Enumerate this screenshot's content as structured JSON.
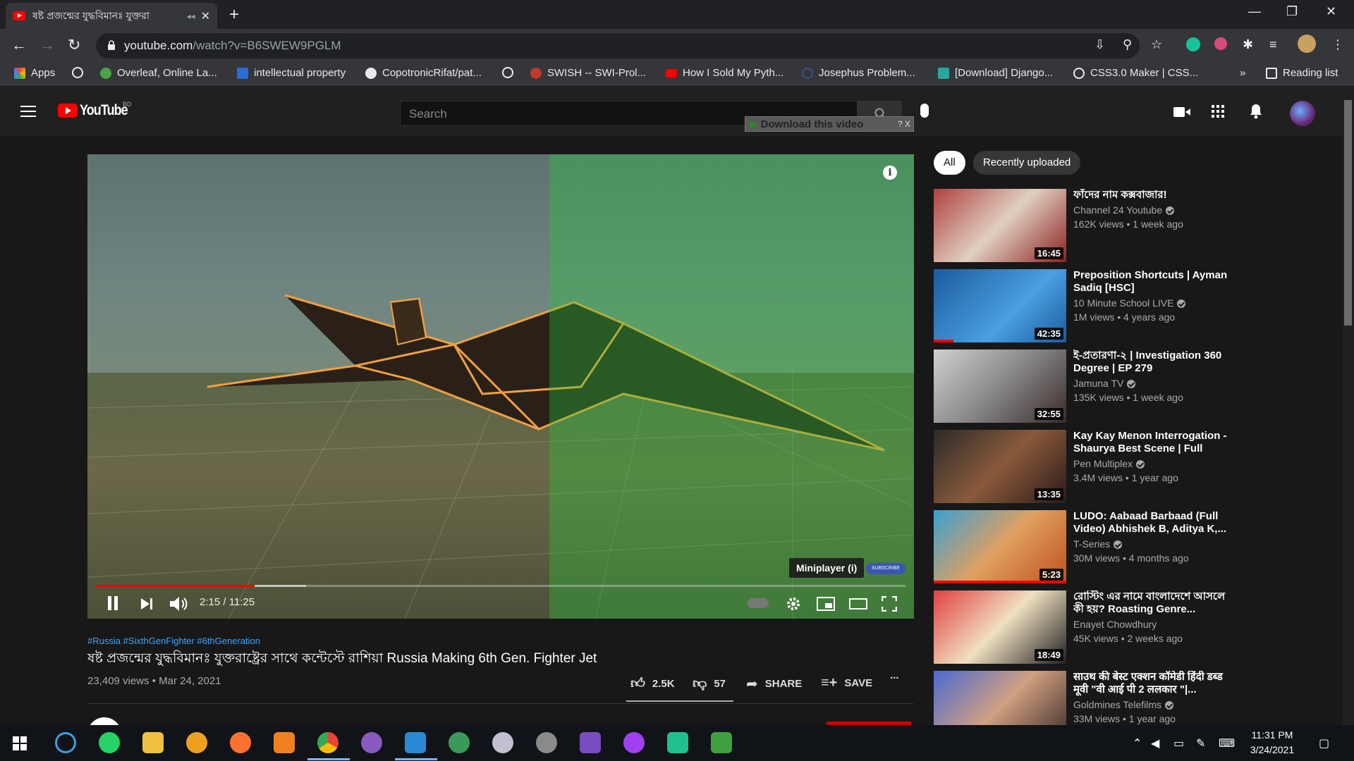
{
  "browser": {
    "tab_title": "ষষ্ট প্রজন্মের যুদ্ধবিমানঃ যুক্তরা",
    "url_host": "youtube.com",
    "url_path": "/watch?v=B6SWEW9PGLM",
    "window_controls": {
      "minimize": "—",
      "restore": "❐",
      "close": "✕"
    }
  },
  "bookmarks": [
    {
      "label": "Apps",
      "color": "#ea4335"
    },
    {
      "label": "",
      "color": "#e8eaed"
    },
    {
      "label": "Overleaf, Online La...",
      "color": "#46a546"
    },
    {
      "label": "intellectual property",
      "color": "#2b6cd6"
    },
    {
      "label": "CopotronicRifat/pat...",
      "color": "#e8eaed"
    },
    {
      "label": "",
      "color": "#e8eaed"
    },
    {
      "label": "SWISH -- SWI-Prol...",
      "color": "#c0392b"
    },
    {
      "label": "How I Sold My Pyth...",
      "color": "#ff0000"
    },
    {
      "label": "Josephus Problem...",
      "color": "#3a6fd6"
    },
    {
      "label": "[Download] Django...",
      "color": "#2aa6a0"
    },
    {
      "label": "CSS3.0 Maker | CSS...",
      "color": "#e8eaed"
    }
  ],
  "bookmarks_more": "»",
  "reading_list": "Reading list",
  "youtube": {
    "logo_text": "YouTube",
    "country": "BD",
    "search_placeholder": "Search",
    "download_overlay": "Download this video",
    "download_overlay_extra": "? X"
  },
  "player": {
    "time": "2:15 / 11:25",
    "progress_fraction": 0.196,
    "miniplayer_tip": "Miniplayer (i)",
    "watermark": "SUBSCRIBE"
  },
  "video": {
    "hashtags": "#Russia #SixthGenFighter #6thGeneration",
    "title": "ষষ্ট প্রজন্মের যুদ্ধবিমানঃ যুক্তরাষ্ট্রের সাথে কন্টেস্টে রাশিয়া Russia Making 6th Gen. Fighter Jet",
    "views_date": "23,409 views • Mar 24, 2021",
    "likes": "2.5K",
    "dislikes": "57",
    "share": "SHARE",
    "save": "SAVE",
    "more": "..."
  },
  "chips": [
    "All",
    "Recently uploaded"
  ],
  "recommendations": [
    {
      "title": "ফাঁদের নাম কক্সবাজার!",
      "channel": "Channel 24 Youtube",
      "views": "162K views • 1 week ago",
      "duration": "16:45",
      "thumb_color": "#b03030"
    },
    {
      "title": "Preposition Shortcuts | Ayman Sadiq [HSC]",
      "channel": "10 Minute School LIVE",
      "views": "1M views • 4 years ago",
      "duration": "42:35",
      "thumb_color": "#2a7ad6"
    },
    {
      "title": "ই-প্রতারণা-২ | Investigation 360 Degree | EP 279",
      "channel": "Jamuna TV",
      "views": "135K views • 1 week ago",
      "duration": "32:55",
      "thumb_color": "#a8a8a8"
    },
    {
      "title": "Kay Kay Menon Interrogation - Shaurya Best Scene | Full Hind...",
      "channel": "Pen Multiplex",
      "views": "3.4M views • 1 year ago",
      "duration": "13:35",
      "thumb_color": "#5a3a2a"
    },
    {
      "title": "LUDO: Aabaad Barbaad (Full Video) Abhishek B, Aditya K,...",
      "channel": "T-Series",
      "views": "30M views • 4 months ago",
      "duration": "5:23",
      "thumb_color": "#d07830"
    },
    {
      "title": "রোস্টিং এর নামে বাংলাদেশে আসলে কী হয়? Roasting Genre...",
      "channel": "Enayet Chowdhury",
      "views": "45K views • 2 weeks ago",
      "duration": "18:49",
      "thumb_color": "#c03030"
    },
    {
      "title": "साउथ की बेस्ट एक्शन कॉमेडी हिंदी डब्ड मूवी \"वी आई पी 2 ललकार \"|...",
      "channel": "Goldmines Telefilms",
      "views": "33M views • 1 year ago",
      "duration": "",
      "thumb_color": "#6a4a3a"
    }
  ],
  "taskbar": {
    "time": "11:31 PM",
    "date": "3/24/2021",
    "apps": [
      "windows-start",
      "search",
      "whatsapp",
      "file-explorer",
      "vpn",
      "firefox",
      "paint",
      "chrome",
      "github-desktop",
      "vscode",
      "earth",
      "photos",
      "satellite",
      "visual-studio",
      "messenger",
      "pycharm",
      "notepad"
    ]
  }
}
